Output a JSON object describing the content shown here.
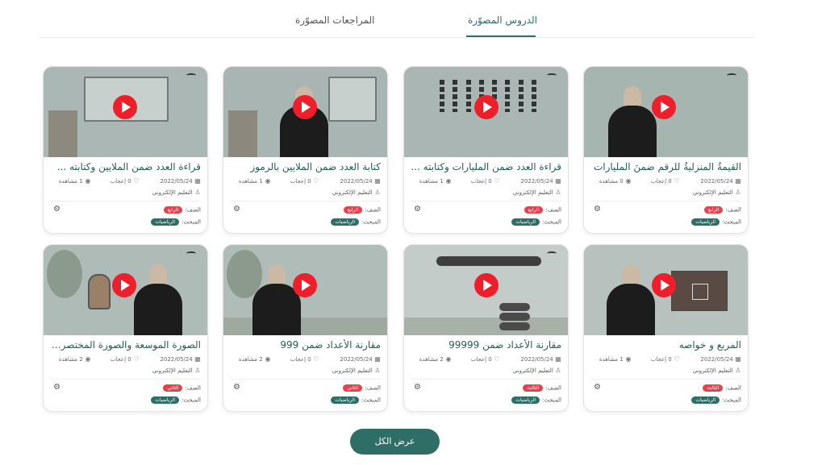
{
  "tabs": [
    {
      "label": "الدروس المصوّرة",
      "active": true
    },
    {
      "label": "المراجعات المصوّرة",
      "active": false
    }
  ],
  "labels": {
    "grade_prefix": "الصف:",
    "subject_prefix": "المبحث:",
    "views_suffix": "مشاهدة",
    "likes_suffix": "إعجاب"
  },
  "colors": {
    "brand": "#2e6e66",
    "play": "#ee1f2a",
    "grade_pill": "#e2434c"
  },
  "icons": {
    "date": "calendar-icon",
    "likes": "heart-icon",
    "views": "eye-icon",
    "teacher": "user-icon",
    "settings": "gear-icon",
    "play": "play-icon"
  },
  "cards": [
    {
      "title": "القيمةُ المنزليةُ للرقمِ ضمنَ المليارات",
      "date": "2022/05/24",
      "likes": "0",
      "views": "0",
      "teacher": "التعليم الإلكتروني",
      "grade": "الرابع",
      "subject": "الرياضيات"
    },
    {
      "title": "قراءة العدد ضمن المليارات وكتابته ...",
      "date": "2022/05/24",
      "likes": "0",
      "views": "1",
      "teacher": "التعليم الإلكتروني",
      "grade": "الرابع",
      "subject": "الرياضيات"
    },
    {
      "title": "كتابة العدد ضمن الملايين بالرموز",
      "date": "2022/05/24",
      "likes": "0",
      "views": "1",
      "teacher": "التعليم الإلكتروني",
      "grade": "الرابع",
      "subject": "الرياضيات"
    },
    {
      "title": "قراءة العدد ضمن الملايين وكتابته ...",
      "date": "2022/05/24",
      "likes": "0",
      "views": "1",
      "teacher": "التعليم الإلكتروني",
      "grade": "الرابع",
      "subject": "الرياضيات"
    },
    {
      "title": "المربع و خواصه",
      "date": "2022/05/24",
      "likes": "0",
      "views": "1",
      "teacher": "التعليم الإلكتروني",
      "grade": "الثالث",
      "subject": "الرياضيات"
    },
    {
      "title": "مقارنة الأعداد ضمن 99999",
      "date": "2022/05/24",
      "likes": "0",
      "views": "2",
      "teacher": "التعليم الإلكتروني",
      "grade": "الثالث",
      "subject": "الرياضيات"
    },
    {
      "title": "مقارنة الأعداد ضمن 999",
      "date": "2022/05/24",
      "likes": "0",
      "views": "2",
      "teacher": "التعليم الإلكتروني",
      "grade": "الثاني",
      "subject": "الرياضيات"
    },
    {
      "title": "الصورة الموسعة والصورة المختصرة ...",
      "date": "2022/05/24",
      "likes": "0",
      "views": "2",
      "teacher": "التعليم الإلكتروني",
      "grade": "الثاني",
      "subject": "الرياضيات"
    }
  ],
  "show_all_label": "عرض الكل"
}
